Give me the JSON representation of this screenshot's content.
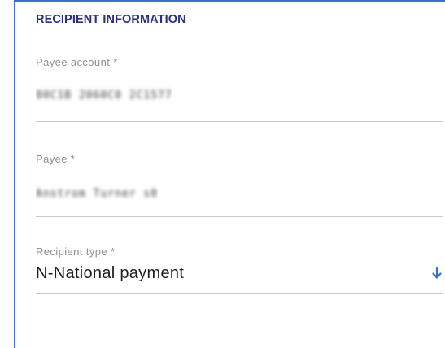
{
  "section": {
    "title": "RECIPIENT INFORMATION"
  },
  "fields": {
    "payee_account": {
      "label": "Payee account *",
      "value": "80C1B 2060C0 2C1577"
    },
    "payee": {
      "label": "Payee *",
      "value": "Anstrom Turner s0"
    },
    "recipient_type": {
      "label": "Recipient type *",
      "value": "N-National payment",
      "icon": "arrow-down-icon"
    }
  },
  "colors": {
    "accent": "#3f6fce",
    "title": "#2b2f80",
    "label": "#8a8f9c",
    "arrow": "#2f6fd6"
  }
}
